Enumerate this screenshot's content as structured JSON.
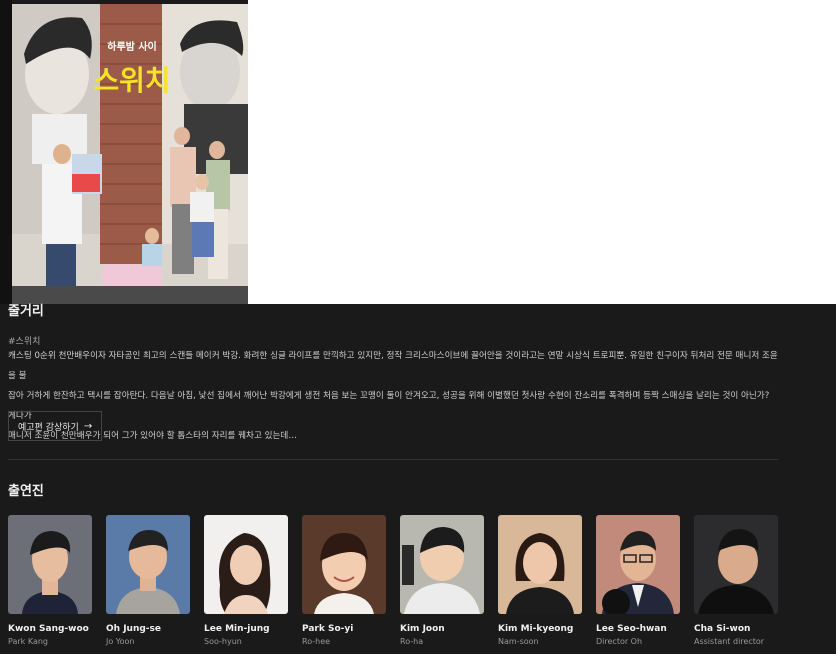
{
  "poster": {
    "tagline": "하루밤 사이",
    "title": "스위치"
  },
  "synopsis": {
    "heading": "줄거리",
    "hashtag": "#스위치",
    "lines": [
      "캐스팅 0순위 천만배우이자 자타공인 최고의 스캔들 메이커 박강. 화려한 싱글 라이프를 만끽하고 있지만, 정작 크리스마스이브에 끌어안을 것이라고는 연말 시상식 트로피뿐. 유일한 친구이자 뒤처리 전문 매니저 조윤을 불",
      "잡아 거하게 한잔하고 택시를 잡아탄다. 다음날 아침, 낯선 집에서 깨어난 박강에게 생전 처음 보는 꼬맹이 둘이 안겨오고, 성공을 위해 이별했던 첫사랑 수현이 잔소리를 폭격하며 등짝 스매싱을 날리는 것이 아닌가? 게다가",
      "매니저 조윤이 천만배우가 되어 그가 있어야 할 톱스타의 자리를 꿰차고 있는데…"
    ],
    "trailer_button": "예고편 감상하기",
    "trailer_icon": "arrow-right-icon"
  },
  "cast": {
    "heading": "출연진",
    "members": [
      {
        "name": "Kwon Sang-woo",
        "role": "Park Kang",
        "bg": "#6c6f78"
      },
      {
        "name": "Oh Jung-se",
        "role": "Jo Yoon",
        "bg": "#5a7aa8"
      },
      {
        "name": "Lee Min-jung",
        "role": "Soo-hyun",
        "bg": "#f2f0ee"
      },
      {
        "name": "Park So-yi",
        "role": "Ro-hee",
        "bg": "#5a3a2a"
      },
      {
        "name": "Kim Joon",
        "role": "Ro-ha",
        "bg": "#b8b8b0"
      },
      {
        "name": "Kim Mi-kyeong",
        "role": "Nam-soon",
        "bg": "#d9b89a"
      },
      {
        "name": "Lee Seo-hwan",
        "role": "Director Oh",
        "bg": "#c28a7a"
      },
      {
        "name": "Cha Si-won",
        "role": "Assistant director",
        "bg": "#2c2c2e"
      }
    ]
  }
}
